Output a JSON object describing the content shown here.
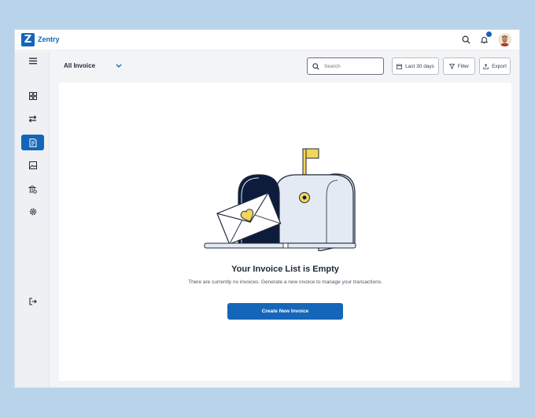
{
  "app": {
    "logo_letter": "Z",
    "name": "Zentry"
  },
  "header": {
    "notification_count": "",
    "icons": [
      "search-icon",
      "bell-icon",
      "avatar"
    ]
  },
  "sidebar": {
    "items": [
      {
        "name": "menu",
        "icon": "hamburger-icon"
      },
      {
        "name": "dashboard",
        "icon": "grid-icon"
      },
      {
        "name": "transfers",
        "icon": "arrows-icon"
      },
      {
        "name": "invoices",
        "icon": "invoice-icon",
        "active": true
      },
      {
        "name": "reports",
        "icon": "image-icon"
      },
      {
        "name": "bank",
        "icon": "bank-icon"
      },
      {
        "name": "settings",
        "icon": "gear-icon"
      },
      {
        "name": "logout",
        "icon": "logout-icon"
      }
    ]
  },
  "toolbar": {
    "filter_view": "All Invoice",
    "search_placeholder": "Search",
    "date_range": "Last 30 days",
    "filter_label": "Filter",
    "export_label": "Export"
  },
  "empty_state": {
    "title": "Your Invoice List is Empty",
    "description": "There are currently no invoices. Generate a new invoice to manage your transactions.",
    "button_label": "Create New Invoice"
  },
  "colors": {
    "primary": "#1466b8",
    "background": "#b9d3ea",
    "mailbox_dark": "#0d1b3d",
    "mailbox_light": "#e3eaf3",
    "accent_yellow": "#f5d45b"
  }
}
